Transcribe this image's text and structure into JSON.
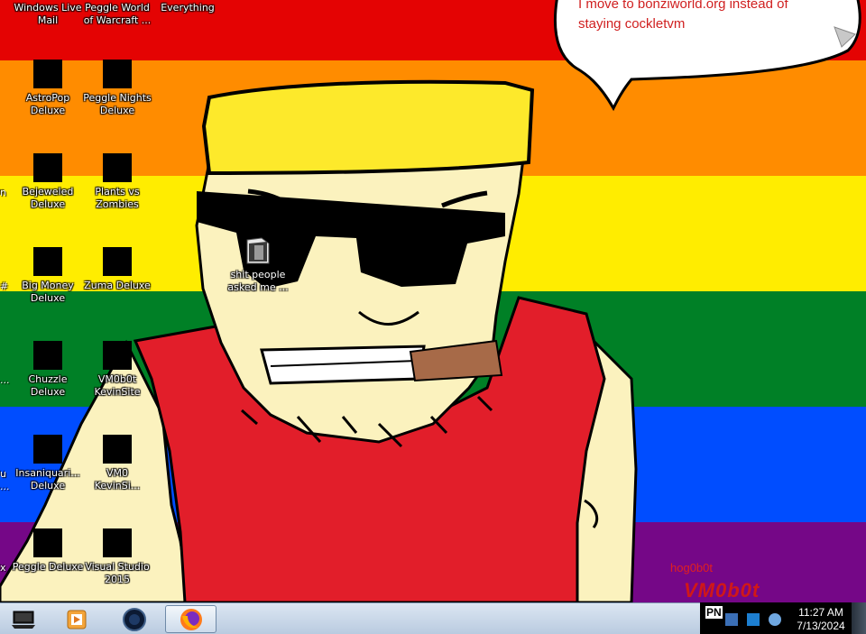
{
  "wallpaper": {
    "bands": [
      "#e40303",
      "#ff8c00",
      "#ffed00",
      "#008026",
      "#004dff",
      "#750787"
    ],
    "speech_bubble_text": "I move to bonziworld.org instead of\nstaying cockletvm",
    "artist_signature": "hog0b0t",
    "vm_signature": "VM0b0t"
  },
  "desktop": {
    "icons": [
      {
        "label": "Windows Live\nMail",
        "icon": "windows-live-mail-icon"
      },
      {
        "label": "Peggle World\nof Warcraft ...",
        "icon": "peggle-wow-icon"
      },
      {
        "label": "Everything",
        "icon": "everything-search-icon"
      },
      {
        "label": "AstroPop\nDeluxe",
        "icon": "astropop-icon"
      },
      {
        "label": "Peggle Nights\nDeluxe",
        "icon": "peggle-nights-icon"
      },
      {
        "label": "Bejeweled\nDeluxe",
        "icon": "bejeweled-icon"
      },
      {
        "label": "Plants vs\nZombies",
        "icon": "plants-vs-zombies-icon"
      },
      {
        "label": "shit people\nasked me ...",
        "icon": "folder-icon"
      },
      {
        "label": "Big Money\nDeluxe",
        "icon": "big-money-icon"
      },
      {
        "label": "Zuma Deluxe",
        "icon": "zuma-icon"
      },
      {
        "label": "Chuzzle\nDeluxe",
        "icon": "chuzzle-icon"
      },
      {
        "label": "VM0b0t\nKevinSite",
        "icon": "kevinsite-icon"
      },
      {
        "label": "Insaniquari...\nDeluxe",
        "icon": "insaniquarium-icon"
      },
      {
        "label": "VM0\nKevinSi...",
        "icon": "kevinsite-2-icon"
      },
      {
        "label": "Peggle Deluxe",
        "icon": "peggle-deluxe-icon"
      },
      {
        "label": "Visual Studio\n2015",
        "icon": "visual-studio-icon"
      }
    ],
    "edge_fragments": [
      {
        "label": "n"
      },
      {
        "label": "#"
      },
      {
        "label": "..."
      },
      {
        "label": "u\n..."
      },
      {
        "label": "x"
      }
    ]
  },
  "taskbar": {
    "buttons": [
      {
        "name": "computer-icon"
      },
      {
        "name": "media-player-icon"
      },
      {
        "name": "internet-icon"
      },
      {
        "name": "firefox-icon",
        "active": true
      }
    ],
    "tray": {
      "language": "PN",
      "time": "11:27 AM",
      "date": "7/13/2024"
    }
  }
}
